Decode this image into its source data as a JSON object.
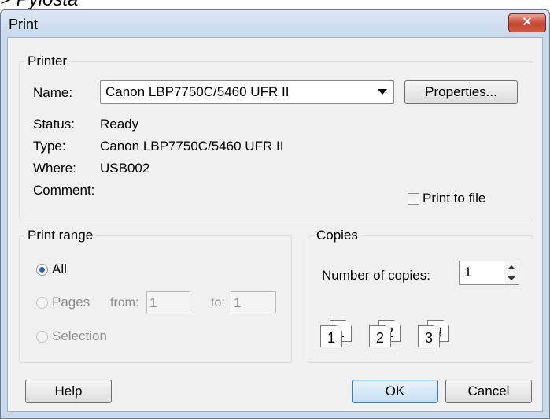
{
  "top_fragment": "> Руlosta",
  "window": {
    "title": "Print",
    "close_glyph": "✕"
  },
  "printer": {
    "legend": "Printer",
    "name_label": "Name:",
    "name_value": "Canon LBP7750C/5460 UFR II",
    "properties_label": "Properties...",
    "status_label": "Status:",
    "status_value": "Ready",
    "type_label": "Type:",
    "type_value": "Canon LBP7750C/5460 UFR II",
    "where_label": "Where:",
    "where_value": "USB002",
    "comment_label": "Comment:",
    "print_to_file_label": "Print to file",
    "print_to_file_checked": false
  },
  "print_range": {
    "legend": "Print range",
    "all_label": "All",
    "pages_label": "Pages",
    "from_label": "from:",
    "from_value": "1",
    "to_label": "to:",
    "to_value": "1",
    "selection_label": "Selection",
    "selected": "All"
  },
  "copies": {
    "legend": "Copies",
    "number_label": "Number of copies:",
    "number_value": "1",
    "collate_pages": [
      "1",
      "1",
      "2",
      "2",
      "3",
      "3"
    ]
  },
  "buttons": {
    "help": "Help",
    "ok": "OK",
    "cancel": "Cancel"
  }
}
